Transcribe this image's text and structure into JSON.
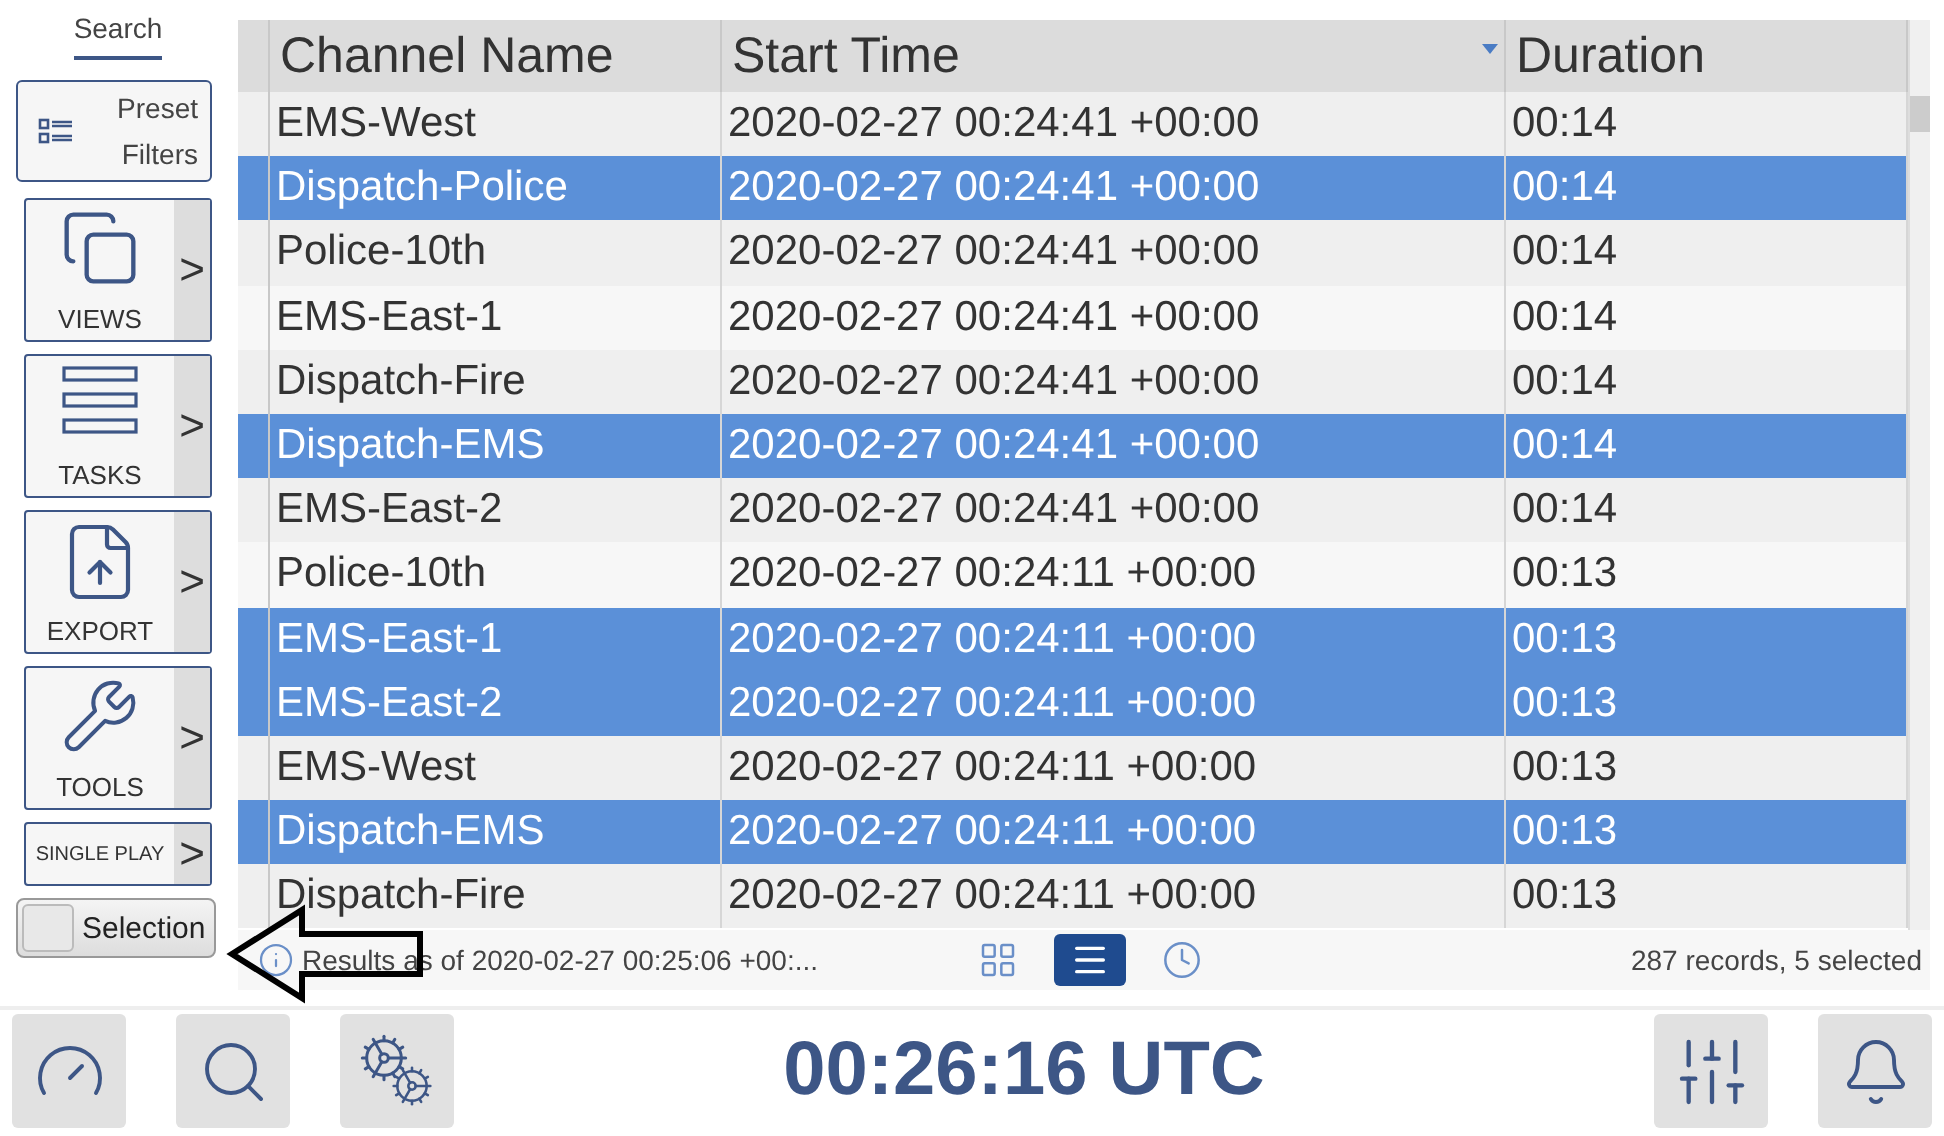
{
  "sidebar": {
    "search_tab": {
      "label": "Search",
      "selected": true
    },
    "preset_filters": {
      "label": "Preset Filters"
    },
    "menu_buttons": [
      {
        "kind": "views",
        "label": "VIEWS",
        "chevron": ">"
      },
      {
        "kind": "tasks",
        "label": "TASKS",
        "chevron": ">"
      },
      {
        "kind": "export",
        "label": "EXPORT",
        "chevron": ">"
      },
      {
        "kind": "tools",
        "label": "TOOLS",
        "chevron": ">"
      },
      {
        "kind": "compact",
        "label": "SINGLE PLAY",
        "chevron": ">"
      }
    ],
    "selection_toggle": {
      "label": "Selection",
      "on": false
    }
  },
  "table": {
    "columns": [
      {
        "label": "Channel Name",
        "sorted": false
      },
      {
        "label": "Start Time",
        "sorted": true
      },
      {
        "label": "Duration",
        "sorted": false
      }
    ],
    "rows": [
      {
        "channel": "EMS-West",
        "start": "2020-02-27 00:24:41 +00:00",
        "duration": "00:14",
        "selected": false
      },
      {
        "channel": "Dispatch-Police",
        "start": "2020-02-27 00:24:41 +00:00",
        "duration": "00:14",
        "selected": true
      },
      {
        "channel": "Police-10th",
        "start": "2020-02-27 00:24:41 +00:00",
        "duration": "00:14",
        "selected": false
      },
      {
        "channel": "EMS-East-1",
        "start": "2020-02-27 00:24:41 +00:00",
        "duration": "00:14",
        "selected": false
      },
      {
        "channel": "Dispatch-Fire",
        "start": "2020-02-27 00:24:41 +00:00",
        "duration": "00:14",
        "selected": false
      },
      {
        "channel": "Dispatch-EMS",
        "start": "2020-02-27 00:24:41 +00:00",
        "duration": "00:14",
        "selected": true
      },
      {
        "channel": "EMS-East-2",
        "start": "2020-02-27 00:24:41 +00:00",
        "duration": "00:14",
        "selected": false
      },
      {
        "channel": "Police-10th",
        "start": "2020-02-27 00:24:11 +00:00",
        "duration": "00:13",
        "selected": false
      },
      {
        "channel": "EMS-East-1",
        "start": "2020-02-27 00:24:11 +00:00",
        "duration": "00:13",
        "selected": true
      },
      {
        "channel": "EMS-East-2",
        "start": "2020-02-27 00:24:11 +00:00",
        "duration": "00:13",
        "selected": true
      },
      {
        "channel": "EMS-West",
        "start": "2020-02-27 00:24:11 +00:00",
        "duration": "00:13",
        "selected": false
      },
      {
        "channel": "Dispatch-EMS",
        "start": "2020-02-27 00:24:11 +00:00",
        "duration": "00:13",
        "selected": true
      },
      {
        "channel": "Dispatch-Fire",
        "start": "2020-02-27 00:24:11 +00:00",
        "duration": "00:13",
        "selected": false
      }
    ]
  },
  "status_bar": {
    "info": "Results as of 2020-02-27 00:25:06 +00:...",
    "view_buttons": [
      {
        "kind": "grid",
        "selected": false
      },
      {
        "kind": "list",
        "selected": true
      },
      {
        "kind": "clock",
        "selected": false
      }
    ],
    "count": "287 records, 5 selected"
  },
  "bottom_bar": {
    "left_buttons": [
      {
        "kind": "gauge"
      },
      {
        "kind": "search"
      },
      {
        "kind": "gears"
      }
    ],
    "clock": "00:26:16 UTC",
    "right_buttons": [
      {
        "kind": "mixer"
      },
      {
        "kind": "bell"
      }
    ]
  }
}
